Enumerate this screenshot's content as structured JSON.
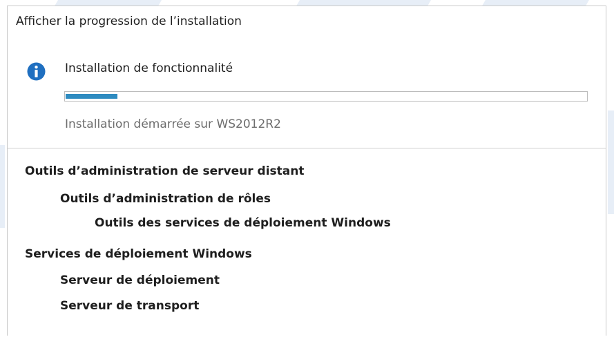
{
  "dialog": {
    "title": "Afficher la progression de l’installation",
    "status_heading": "Installation de fonctionnalité",
    "status_detail": "Installation démarrée sur WS2012R2",
    "progress": 0.1,
    "accent_color": "#2e8bc0",
    "info_icon": "info-icon"
  },
  "features": [
    {
      "label": "Outils d’administration de serveur distant",
      "level": 0
    },
    {
      "label": "Outils d’administration de rôles",
      "level": 1
    },
    {
      "label": "Outils des services de déploiement Windows",
      "level": 2
    },
    {
      "label": "Services de déploiement Windows",
      "level": 0
    },
    {
      "label": "Serveur de déploiement",
      "level": 1
    },
    {
      "label": "Serveur de transport",
      "level": 1
    }
  ]
}
